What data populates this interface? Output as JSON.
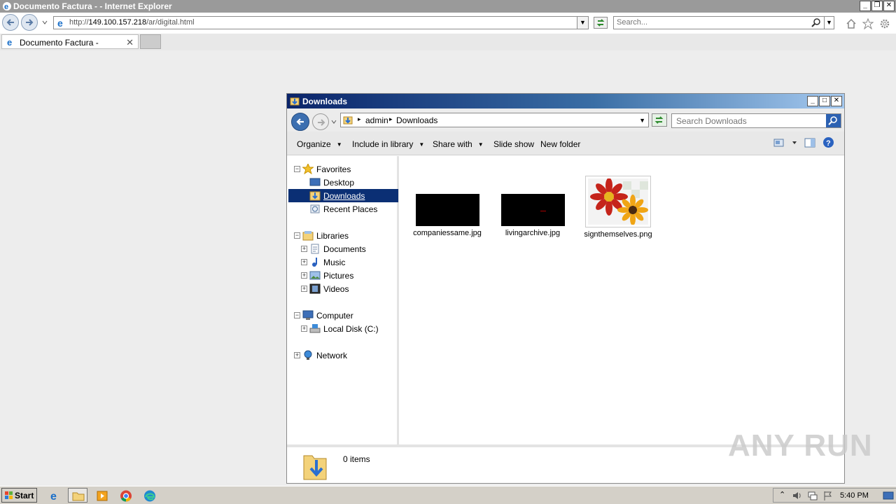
{
  "ie": {
    "title": "Documento Factura - - Internet Explorer",
    "url_prefix": "http://",
    "url_host": "149.100.157.218",
    "url_path": "/ar/digital.html",
    "search_placeholder": "Search...",
    "tab_title": "Documento Factura -",
    "tab_close": "✕",
    "window_buttons": [
      "_",
      "❐",
      "✕"
    ]
  },
  "explorer": {
    "title": "Downloads",
    "breadcrumbs": [
      "admin",
      "Downloads"
    ],
    "search_placeholder": "Search Downloads",
    "window_buttons": [
      "_",
      "□",
      "✕"
    ],
    "toolbar": {
      "organize": "Organize",
      "include_in_library": "Include in library",
      "share_with": "Share with",
      "slide_show": "Slide show",
      "new_folder": "New folder"
    },
    "nav": {
      "favorites": "Favorites",
      "desktop": "Desktop",
      "downloads": "Downloads",
      "recent_places": "Recent Places",
      "libraries": "Libraries",
      "documents": "Documents",
      "music": "Music",
      "pictures": "Pictures",
      "videos": "Videos",
      "computer": "Computer",
      "local_disk": "Local Disk (C:)",
      "network": "Network"
    },
    "files": [
      {
        "name": "companiessame.jpg"
      },
      {
        "name": "livingarchive.jpg"
      },
      {
        "name": "signthemselves.png"
      }
    ],
    "status": "0 items"
  },
  "taskbar": {
    "start": "Start",
    "time": "5:40 PM"
  },
  "watermark": "ANY RUN"
}
